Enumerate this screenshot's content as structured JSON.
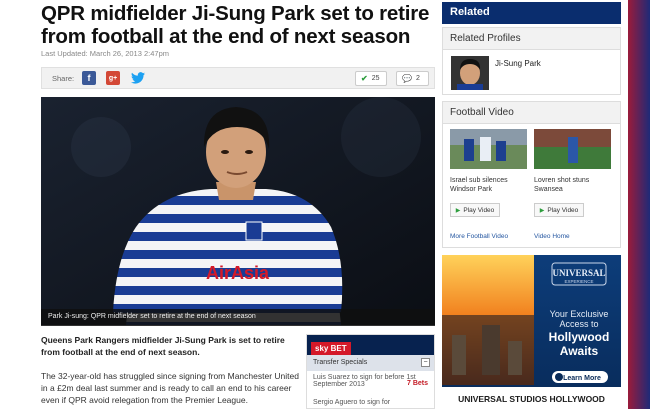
{
  "article": {
    "headline": "QPR midfielder Ji-Sung Park set to retire from football at the end of next season",
    "updated": "Last Updated: March 26, 2013 2:47pm",
    "share_label": "Share:",
    "share": {
      "facebook": "f",
      "googleplus": "g+",
      "twitter": "🐦"
    },
    "likes_count": "25",
    "comments_count": "2",
    "image_caption": "Park Ji-sung: QPR midfielder set to retire at the end of next season",
    "shirt_sponsor": "AirAsia",
    "lede": "Queens Park Rangers midfielder Ji-Sung Park is set to retire from football at the end of next season.",
    "body": "The 32-year-old has struggled since signing from Manchester United in a £2m deal last summer and is ready to call an end to his career even if QPR avoid relegation from the Premier League."
  },
  "bet_widget": {
    "logo_sky": "sky",
    "logo_bet": "BET",
    "tab_label": "Transfer Specials",
    "collapse": "−",
    "rows": [
      {
        "text": "Luis Suarez to sign for before 1st September 2013",
        "odds": "7 Bets"
      },
      {
        "text": "Sergio Aguero to sign for",
        "odds": ""
      }
    ]
  },
  "sidebar": {
    "related_title": "Related",
    "profiles_title": "Related Profiles",
    "profile_name": "Ji-Sung Park",
    "video_title": "Football Video",
    "videos": [
      {
        "caption": "Israel sub silences Windsor Park",
        "play_label": "Play Video"
      },
      {
        "caption": "Lovren shot stuns Swansea",
        "play_label": "Play Video"
      }
    ],
    "more_video": "More Football Video",
    "video_home": "Video Home"
  },
  "ad": {
    "brand": "UNIVERSAL",
    "brand_sub": "EXPERIENCE",
    "tagline_1": "Your Exclusive",
    "tagline_2": "Access to",
    "tagline_3": "Hollywood",
    "tagline_4": "Awaits",
    "cta": "Learn More",
    "footer": "UNIVERSAL STUDIOS HOLLYWOOD"
  },
  "colors": {
    "sky_navy": "#0a2d6e",
    "bet_red": "#d41929",
    "link_blue": "#2456a0"
  }
}
